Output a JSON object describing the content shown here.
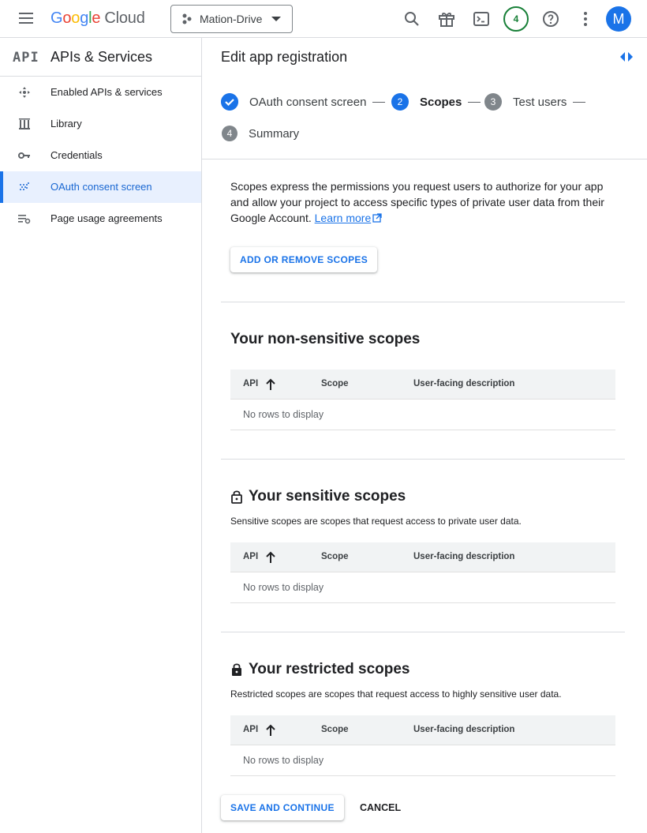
{
  "topbar": {
    "logo": {
      "g1": "G",
      "o1": "o",
      "o2": "o",
      "g2": "g",
      "l": "l",
      "e": "e",
      "cloud": "Cloud"
    },
    "project_name": "Mation-Drive",
    "notification_count": "4",
    "avatar_letter": "M",
    "icons": [
      "menu-icon",
      "search-icon",
      "gift-icon",
      "terminal-icon",
      "help-icon",
      "more-vert-icon"
    ]
  },
  "sidebar": {
    "logo": "API",
    "title": "APIs & Services",
    "items": [
      {
        "label": "Enabled APIs & services",
        "icon": "enabled-apis-icon",
        "active": false
      },
      {
        "label": "Library",
        "icon": "library-icon",
        "active": false
      },
      {
        "label": "Credentials",
        "icon": "key-icon",
        "active": false
      },
      {
        "label": "OAuth consent screen",
        "icon": "oauth-icon",
        "active": true
      },
      {
        "label": "Page usage agreements",
        "icon": "settings-list-icon",
        "active": false
      }
    ]
  },
  "main": {
    "title": "Edit app registration",
    "stepper": [
      {
        "number": "",
        "label": "OAuth consent screen",
        "state": "done"
      },
      {
        "number": "2",
        "label": "Scopes",
        "state": "current"
      },
      {
        "number": "3",
        "label": "Test users",
        "state": "todo"
      },
      {
        "number": "4",
        "label": "Summary",
        "state": "todo"
      }
    ],
    "intro_text": "Scopes express the permissions you request users to authorize for your app and allow your project to access specific types of private user data from their Google Account.",
    "learn_more": "Learn more",
    "add_scopes_button": "ADD OR REMOVE SCOPES",
    "table_columns": {
      "api": "API",
      "scope": "Scope",
      "description": "User-facing description"
    },
    "empty_text": "No rows to display",
    "sections": [
      {
        "title": "Your non-sensitive scopes",
        "description": ""
      },
      {
        "title": "Your sensitive scopes",
        "description": "Sensitive scopes are scopes that request access to private user data."
      },
      {
        "title": "Your restricted scopes",
        "description": "Restricted scopes are scopes that request access to highly sensitive user data."
      }
    ],
    "save_button": "SAVE AND CONTINUE",
    "cancel_button": "CANCEL"
  },
  "colors": {
    "accent": "#1a73e8",
    "notif_green": "#188038",
    "active_bg": "#e8f0fe"
  }
}
